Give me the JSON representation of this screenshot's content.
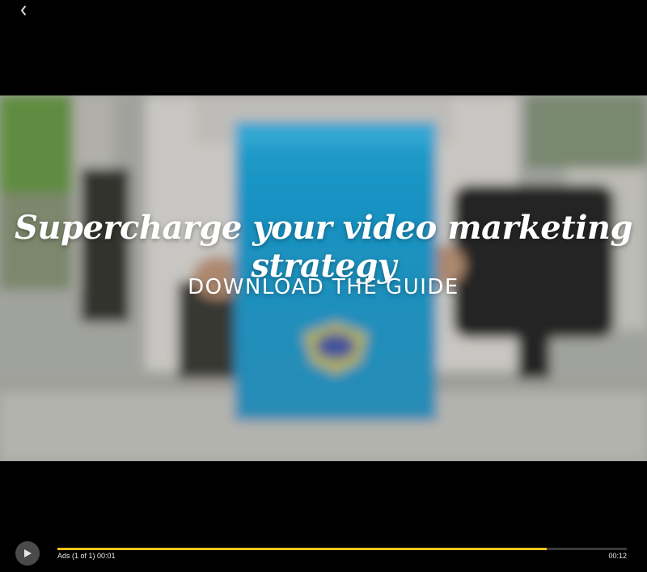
{
  "player": {
    "back_icon": "chevron-left-icon",
    "play_icon": "play-icon"
  },
  "video": {
    "headline": "Supercharge your video marketing strategy",
    "cta": "DOWNLOAD THE GUIDE"
  },
  "controls": {
    "ads_label": "Ads (1 of 1) 00:01",
    "duration": "00:12",
    "progress_fraction": 0.859,
    "progress_color": "#f1c21b"
  }
}
